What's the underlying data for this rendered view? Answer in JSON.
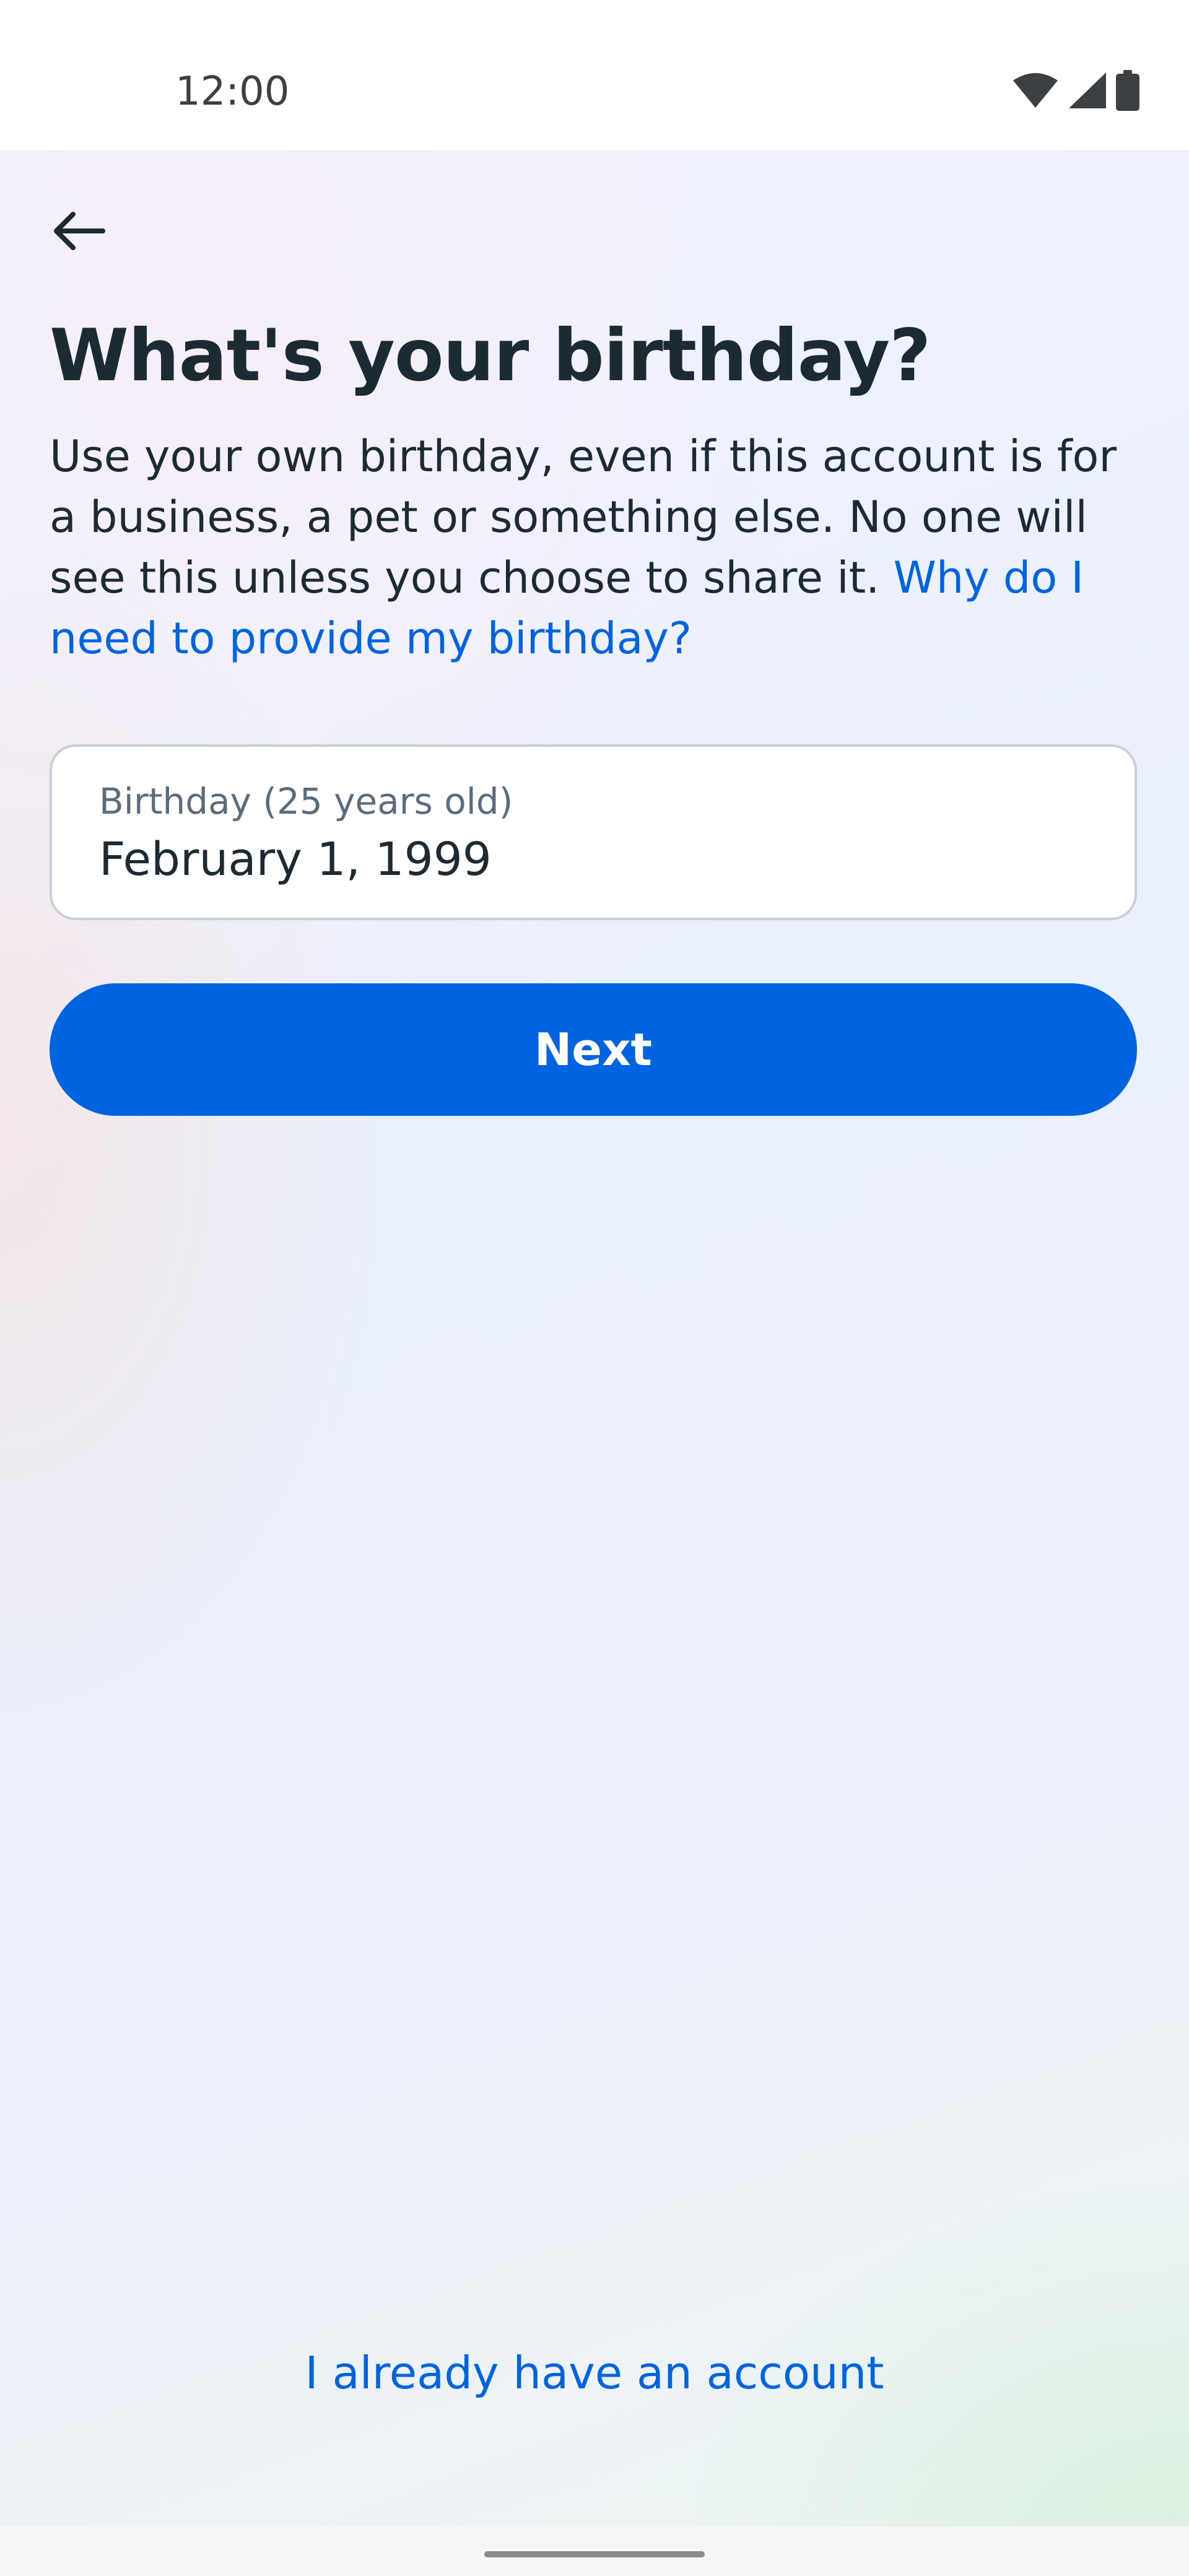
{
  "status_bar": {
    "time": "12:00",
    "icons": [
      "wifi-icon",
      "signal-icon",
      "battery-icon"
    ]
  },
  "header": {
    "back_icon": "arrow-left-icon"
  },
  "main": {
    "title": "What's your birthday?",
    "description": "Use your own birthday, even if this account is for a business, a pet or something else. No one will see this unless you choose to share it. ",
    "description_link": "Why do I need to provide my birthday?",
    "birthday_field": {
      "label": "Birthday (25 years old)",
      "value": "February 1, 1999"
    },
    "next_label": "Next"
  },
  "footer": {
    "login_link": "I already have an account"
  },
  "colors": {
    "accent": "#0064e0",
    "text_primary": "#1c2b33",
    "text_secondary": "#5d6c7b"
  }
}
